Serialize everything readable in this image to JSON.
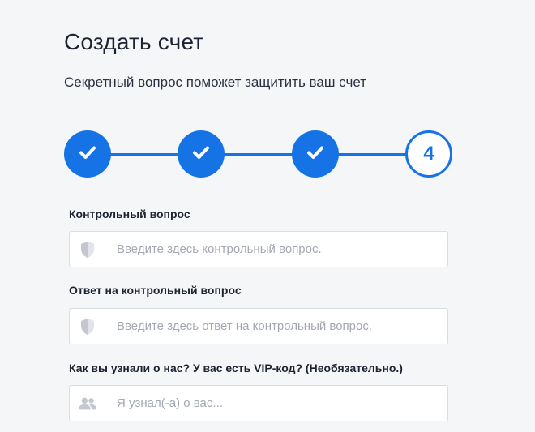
{
  "header": {
    "title": "Создать счет",
    "subtitle": "Секретный вопрос поможет защитить ваш счет"
  },
  "stepper": {
    "steps": [
      {
        "state": "completed",
        "icon": "check-icon"
      },
      {
        "state": "completed",
        "icon": "check-icon"
      },
      {
        "state": "completed",
        "icon": "check-icon"
      },
      {
        "state": "current",
        "number": "4"
      }
    ],
    "accent_color": "#1673e6"
  },
  "form": {
    "security_question": {
      "label": "Контрольный вопрос",
      "placeholder": "Введите здесь контрольный вопрос.",
      "value": "",
      "icon": "shield-icon"
    },
    "security_answer": {
      "label": "Ответ на контрольный вопрос",
      "placeholder": "Введите здесь ответ на контрольный вопрос.",
      "value": "",
      "icon": "shield-icon"
    },
    "referral": {
      "label": "Как вы узнали о нас? У вас есть VIP-код? (Необязательно.)",
      "placeholder": "Я узнал(-а) о вас...",
      "value": "",
      "icon": "people-icon"
    }
  }
}
